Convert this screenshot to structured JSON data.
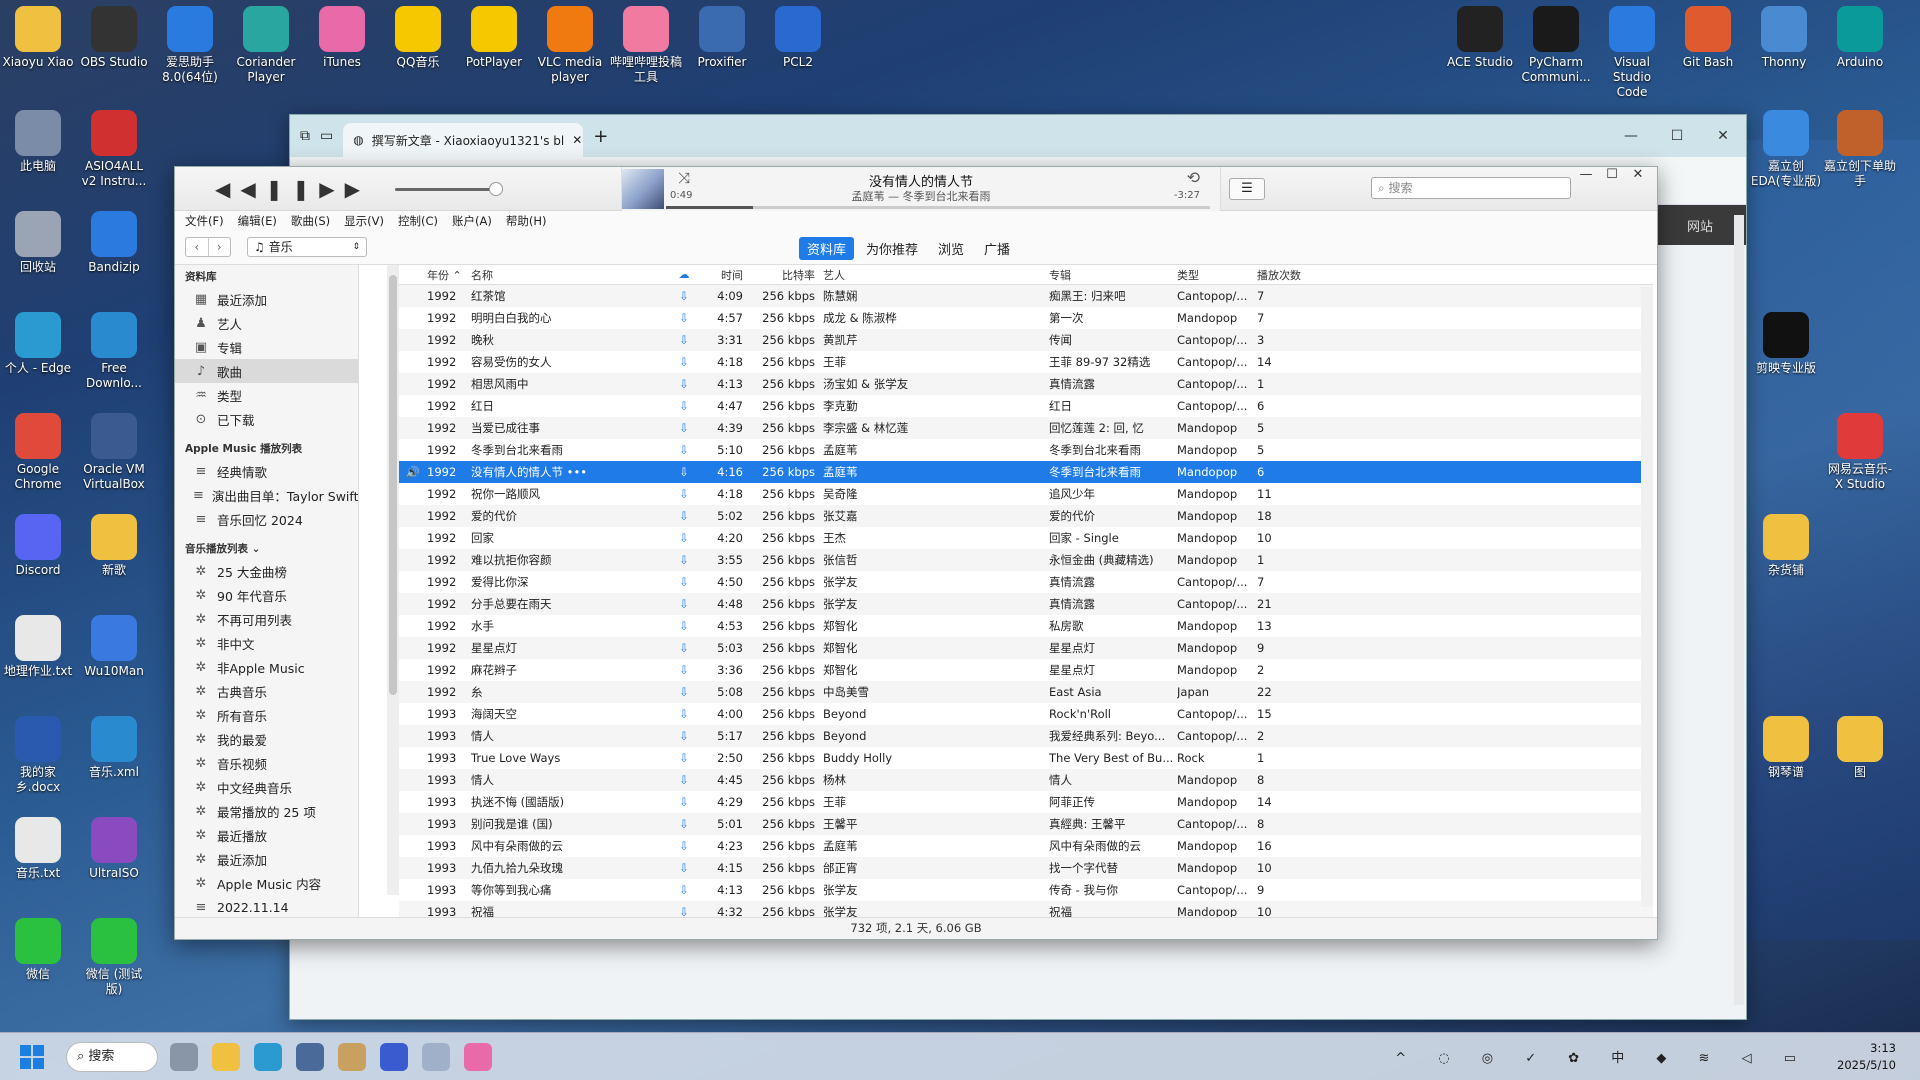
{
  "desktop_icons_left": [
    {
      "label": "Xiaoyu Xiao",
      "color": "#f0c040"
    },
    {
      "label": "OBS Studio",
      "color": "#333333"
    },
    {
      "label": "爱思助手 8.0(64位)",
      "color": "#2a7be0"
    },
    {
      "label": "Coriander Player",
      "color": "#2aa6a0"
    },
    {
      "label": "iTunes",
      "color": "#e86aa8"
    },
    {
      "label": "QQ音乐",
      "color": "#f5c800"
    },
    {
      "label": "PotPlayer",
      "color": "#f5c800"
    },
    {
      "label": "VLC media player",
      "color": "#f07a10"
    },
    {
      "label": "哔哩哔哩投稿工具",
      "color": "#f07aa0"
    },
    {
      "label": "Proxifier",
      "color": "#3a6ab0"
    },
    {
      "label": "PCL2",
      "color": "#2a6ad0"
    }
  ],
  "desktop_icons_col1": [
    {
      "label": "此电脑",
      "color": "#7a8ca8"
    },
    {
      "label": "回收站",
      "color": "#9aa4b4"
    },
    {
      "label": "个人 - Edge",
      "color": "#2a9ad0"
    },
    {
      "label": "Google Chrome",
      "color": "#e04a3a"
    },
    {
      "label": "Discord",
      "color": "#5865f2"
    },
    {
      "label": "地理作业.txt",
      "color": "#e8e8e8"
    },
    {
      "label": "我的家乡.docx",
      "color": "#2a5ab0"
    },
    {
      "label": "音乐.txt",
      "color": "#e8e8e8"
    },
    {
      "label": "微信",
      "color": "#2ac040"
    }
  ],
  "desktop_icons_col2": [
    {
      "label": "ASIO4ALL v2 Instru...",
      "color": "#d03030"
    },
    {
      "label": "Bandizip",
      "color": "#2a7ae0"
    },
    {
      "label": "Free Downlo...",
      "color": "#2a8ad0"
    },
    {
      "label": "Oracle VM VirtualBox",
      "color": "#3a5a90"
    },
    {
      "label": "新歌",
      "color": "#f0c040"
    },
    {
      "label": "Wu10Man",
      "color": "#3a7ae0"
    },
    {
      "label": "音乐.xml",
      "color": "#2a8ad0"
    },
    {
      "label": "UltraISO",
      "color": "#8a4ac0"
    },
    {
      "label": "微信 (测试版)",
      "color": "#2ac040"
    }
  ],
  "desktop_icons_right": [
    {
      "label": "ACE Studio",
      "color": "#222222"
    },
    {
      "label": "PyCharm Communi...",
      "color": "#1a1a1a"
    },
    {
      "label": "Visual Studio Code",
      "color": "#2a7ae0"
    },
    {
      "label": "Git Bash",
      "color": "#e05a30"
    },
    {
      "label": "Thonny",
      "color": "#4a8ad0"
    },
    {
      "label": "Arduino",
      "color": "#0a9a9a"
    }
  ],
  "desktop_icons_right_col": [
    {
      "label": "嘉立创EDA(专业版)",
      "color": "#3a8ae0"
    },
    {
      "label": "剪映专业版",
      "color": "#111111"
    },
    {
      "label": "杂货铺",
      "color": "#f0c040"
    },
    {
      "label": "钢琴谱",
      "color": "#f0c040"
    }
  ],
  "desktop_icons_right_col2": [
    {
      "label": "嘉立创下单助手",
      "color": "#c0602a"
    },
    {
      "label": "网易云音乐-X Studio",
      "color": "#e03a3a"
    },
    {
      "label": "图",
      "color": "#f0c040"
    }
  ],
  "browser": {
    "tab_title": "撰写新文章 - Xiaoxiaoyu1321's bl",
    "right_label": "网站",
    "newtab": "+"
  },
  "itunes": {
    "now_playing_title": "没有情人的情人节",
    "now_playing_sub": "孟庭苇 — 冬季到台北来看雨",
    "elapsed": "0:49",
    "remaining": "-3:27",
    "search_placeholder": "搜索",
    "menu": [
      "文件(F)",
      "编辑(E)",
      "歌曲(S)",
      "显示(V)",
      "控制(C)",
      "账户(A)",
      "帮助(H)"
    ],
    "library_select": "音乐",
    "segments": [
      "资料库",
      "为你推荐",
      "浏览",
      "广播"
    ],
    "sidebar_head1": "资料库",
    "library_items": [
      {
        "icon": "▦",
        "label": "最近添加"
      },
      {
        "icon": "♟",
        "label": "艺人"
      },
      {
        "icon": "▣",
        "label": "专辑"
      },
      {
        "icon": "♪",
        "label": "歌曲"
      },
      {
        "icon": "♒",
        "label": "类型"
      },
      {
        "icon": "⊙",
        "label": "已下载"
      }
    ],
    "sidebar_head2": "Apple Music 播放列表",
    "am_items": [
      {
        "icon": "≡",
        "label": "经典情歌"
      },
      {
        "icon": "≡",
        "label": "演出曲目单：Taylor Swift..."
      },
      {
        "icon": "≡",
        "label": "音乐回忆 2024"
      }
    ],
    "sidebar_head3": "音乐播放列表 ⌄",
    "pl_items": [
      {
        "icon": "✲",
        "label": "25 大金曲榜"
      },
      {
        "icon": "✲",
        "label": "90 年代音乐"
      },
      {
        "icon": "✲",
        "label": "不再可用列表"
      },
      {
        "icon": "✲",
        "label": "非中文"
      },
      {
        "icon": "✲",
        "label": "非Apple Music"
      },
      {
        "icon": "✲",
        "label": "古典音乐"
      },
      {
        "icon": "✲",
        "label": "所有音乐"
      },
      {
        "icon": "✲",
        "label": "我的最爱"
      },
      {
        "icon": "✲",
        "label": "音乐视频"
      },
      {
        "icon": "✲",
        "label": "中文经典音乐"
      },
      {
        "icon": "✲",
        "label": "最常播放的 25 项"
      },
      {
        "icon": "✲",
        "label": "最近播放"
      },
      {
        "icon": "✲",
        "label": "最近添加"
      },
      {
        "icon": "✲",
        "label": "Apple Music 内容"
      },
      {
        "icon": "≡",
        "label": "2022.11.14"
      }
    ],
    "columns": [
      "",
      "年份 ⌃",
      "名称",
      "☁",
      "时间",
      "比特率",
      "艺人",
      "专辑",
      "类型",
      "播放次数"
    ],
    "rows": [
      [
        "1992",
        "红茶馆",
        "4:09",
        "256 kbps",
        "陈慧娴",
        "痴黑王: 归来吧",
        "Cantopop/...",
        "7"
      ],
      [
        "1992",
        "明明白白我的心",
        "4:57",
        "256 kbps",
        "成龙 & 陈淑桦",
        "第一次",
        "Mandopop",
        "7"
      ],
      [
        "1992",
        "晚秋",
        "3:31",
        "256 kbps",
        "黄凯芹",
        "传闻",
        "Cantopop/...",
        "3"
      ],
      [
        "1992",
        "容易受伤的女人",
        "4:18",
        "256 kbps",
        "王菲",
        "王菲 89-97 32精选",
        "Cantopop/...",
        "14"
      ],
      [
        "1992",
        "相思风雨中",
        "4:13",
        "256 kbps",
        "汤宝如 & 张学友",
        "真情流露",
        "Cantopop/...",
        "1"
      ],
      [
        "1992",
        "红日",
        "4:47",
        "256 kbps",
        "李克勤",
        "红日",
        "Cantopop/...",
        "6"
      ],
      [
        "1992",
        "当爱已成往事",
        "4:39",
        "256 kbps",
        "李宗盛 & 林忆莲",
        "回忆莲莲 2: 回, 忆",
        "Mandopop",
        "5"
      ],
      [
        "1992",
        "冬季到台北来看雨",
        "5:10",
        "256 kbps",
        "孟庭苇",
        "冬季到台北来看雨",
        "Mandopop",
        "5"
      ],
      [
        "1992",
        "没有情人的情人节 •••",
        "4:16",
        "256 kbps",
        "孟庭苇",
        "冬季到台北来看雨",
        "Mandopop",
        "6"
      ],
      [
        "1992",
        "祝你一路顺风",
        "4:18",
        "256 kbps",
        "吴奇隆",
        "追风少年",
        "Mandopop",
        "11"
      ],
      [
        "1992",
        "爱的代价",
        "5:02",
        "256 kbps",
        "张艾嘉",
        "爱的代价",
        "Mandopop",
        "18"
      ],
      [
        "1992",
        "回家",
        "4:20",
        "256 kbps",
        "王杰",
        "回家 - Single",
        "Mandopop",
        "10"
      ],
      [
        "1992",
        "难以抗拒你容颜",
        "3:55",
        "256 kbps",
        "张信哲",
        "永恒金曲 (典藏精选)",
        "Mandopop",
        "1"
      ],
      [
        "1992",
        "爱得比你深",
        "4:50",
        "256 kbps",
        "张学友",
        "真情流露",
        "Cantopop/...",
        "7"
      ],
      [
        "1992",
        "分手总要在雨天",
        "4:48",
        "256 kbps",
        "张学友",
        "真情流露",
        "Cantopop/...",
        "21"
      ],
      [
        "1992",
        "水手",
        "4:53",
        "256 kbps",
        "郑智化",
        "私房歌",
        "Mandopop",
        "13"
      ],
      [
        "1992",
        "星星点灯",
        "5:03",
        "256 kbps",
        "郑智化",
        "星星点灯",
        "Mandopop",
        "9"
      ],
      [
        "1992",
        "麻花辫子",
        "3:36",
        "256 kbps",
        "郑智化",
        "星星点灯",
        "Mandopop",
        "2"
      ],
      [
        "1992",
        "糸",
        "5:08",
        "256 kbps",
        "中岛美雪",
        "East Asia",
        "Japan",
        "22"
      ],
      [
        "1993",
        "海阔天空",
        "4:00",
        "256 kbps",
        "Beyond",
        "Rock'n'Roll",
        "Cantopop/...",
        "15"
      ],
      [
        "1993",
        "情人",
        "5:17",
        "256 kbps",
        "Beyond",
        "我爱经典系列: Beyo...",
        "Cantopop/...",
        "2"
      ],
      [
        "1993",
        "True Love Ways",
        "2:50",
        "256 kbps",
        "Buddy Holly",
        "The Very Best of Bu...",
        "Rock",
        "1"
      ],
      [
        "1993",
        "情人",
        "4:45",
        "256 kbps",
        "杨林",
        "情人",
        "Mandopop",
        "8"
      ],
      [
        "1993",
        "执迷不悔 (國語版)",
        "4:29",
        "256 kbps",
        "王菲",
        "阿菲正传",
        "Mandopop",
        "14"
      ],
      [
        "1993",
        "别问我是谁 (国)",
        "5:01",
        "256 kbps",
        "王馨平",
        "真經典: 王馨平",
        "Cantopop/...",
        "8"
      ],
      [
        "1993",
        "风中有朵雨做的云",
        "4:23",
        "256 kbps",
        "孟庭苇",
        "风中有朵雨做的云",
        "Mandopop",
        "16"
      ],
      [
        "1993",
        "九佰九拾九朵玫瑰",
        "4:15",
        "256 kbps",
        "邰正宵",
        "找一个字代替",
        "Mandopop",
        "10"
      ],
      [
        "1993",
        "等你等到我心痛",
        "4:13",
        "256 kbps",
        "张学友",
        "传奇 - 我与你",
        "Cantopop/...",
        "9"
      ],
      [
        "1993",
        "祝福",
        "4:32",
        "256 kbps",
        "张学友",
        "祝福",
        "Mandopop",
        "10"
      ]
    ],
    "selected_row_index": 8,
    "speaker_icon": "🔊",
    "cloud_icon": "⇩",
    "status": "732 项, 2.1 天, 6.06 GB"
  },
  "taskbar": {
    "search_label": "搜索",
    "tray_text": "^ ◌ ◎ ✓ ✿ 中 ◆ ≋ ◁ ▭",
    "time": "3:13",
    "date": "2025/5/10"
  }
}
